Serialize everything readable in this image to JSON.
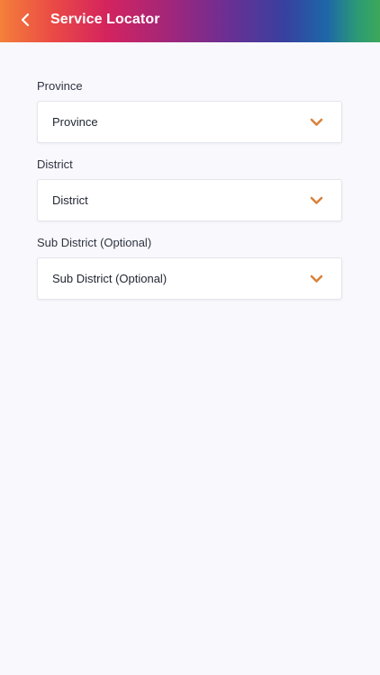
{
  "header": {
    "title": "Service Locator",
    "back_icon": "chevron-left-icon",
    "gradient": [
      "#f4803a",
      "#ea4a45",
      "#d4245e",
      "#a0267b",
      "#6b2f93",
      "#37419f",
      "#1d67a8",
      "#3da85a"
    ]
  },
  "form": {
    "fields": [
      {
        "label": "Province",
        "value": "Province"
      },
      {
        "label": "District",
        "value": "District"
      },
      {
        "label": "Sub District (Optional)",
        "value": "Sub District (Optional)"
      }
    ],
    "dropdown_icon": "chevron-down-icon",
    "accent_color": "#d9823b"
  }
}
